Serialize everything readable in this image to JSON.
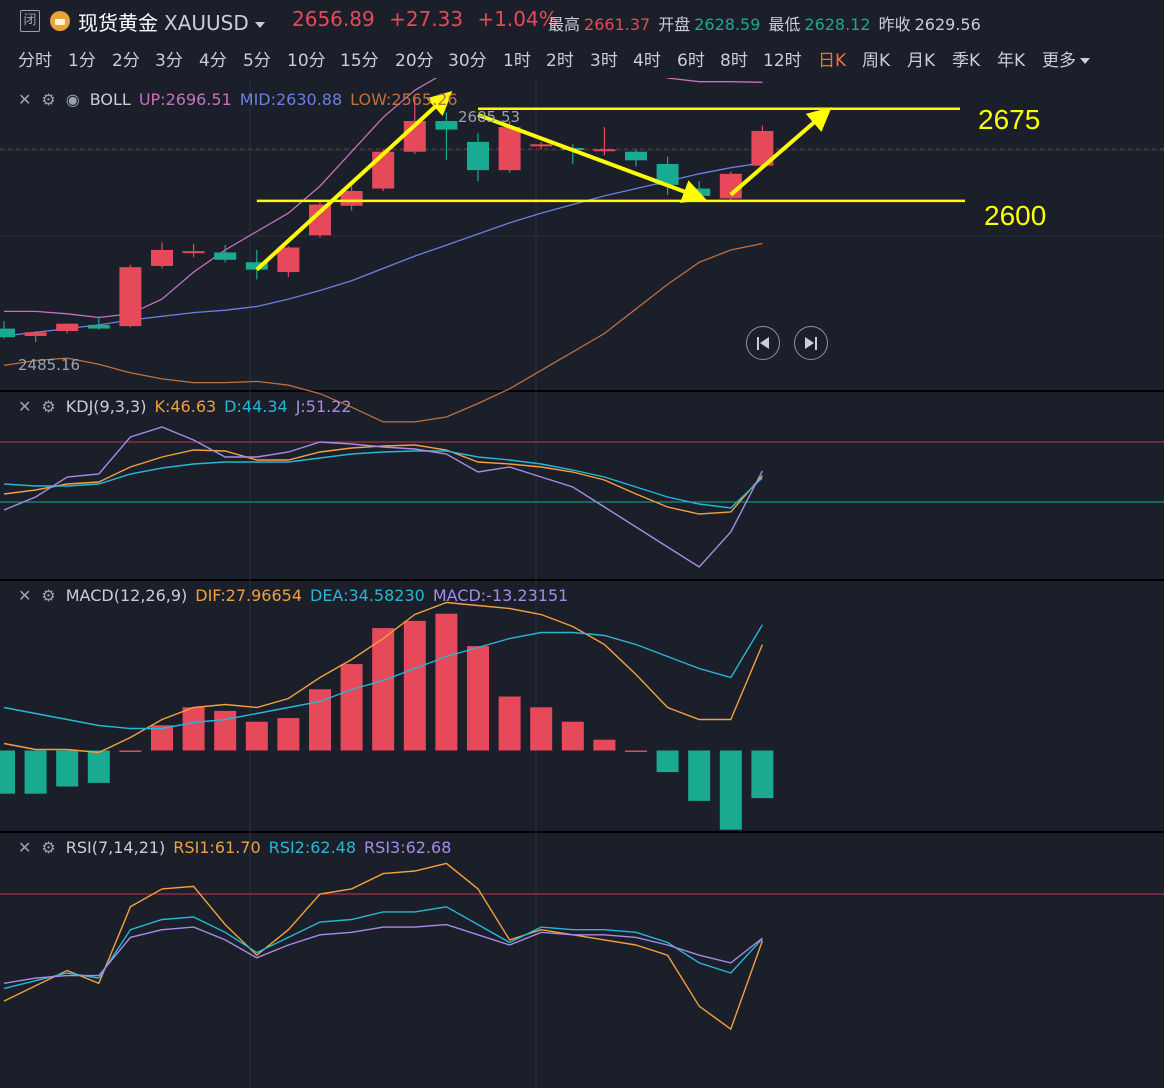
{
  "header": {
    "close_label": "闭",
    "symbol_name": "现货黄金",
    "symbol_code": "XAUUSD",
    "last_price": "2656.89",
    "change": "+27.33",
    "change_pct": "+1.04%",
    "high_label": "最高",
    "high_value": "2661.37",
    "open_label": "开盘",
    "open_value": "2628.59",
    "low_label": "最低",
    "low_value": "2628.12",
    "prev_close_label": "昨收",
    "prev_close_value": "2629.56"
  },
  "tabs": [
    "分时",
    "1分",
    "2分",
    "3分",
    "4分",
    "5分",
    "10分",
    "15分",
    "20分",
    "30分",
    "1时",
    "2时",
    "3时",
    "4时",
    "6时",
    "8时",
    "12时",
    "日K",
    "周K",
    "月K",
    "季K",
    "年K",
    "更多"
  ],
  "active_tab": "日K",
  "colors": {
    "up": "#e64a5a",
    "down": "#1aa991",
    "annot": "#ffff00",
    "boll_up": "#c86fc3",
    "boll_mid": "#6b7fe0",
    "boll_low": "#c06f3e"
  },
  "panels": {
    "boll": {
      "name": "BOLL",
      "up": "UP:2696.51",
      "mid": "MID:2630.88",
      "low": "LOW:2565.26",
      "max_label": "2685.53",
      "min_label": "2485.16"
    },
    "kdj": {
      "name": "KDJ(9,3,3)",
      "k": "K:46.63",
      "d": "D:44.34",
      "j": "J:51.22"
    },
    "macd": {
      "name": "MACD(12,26,9)",
      "dif": "DIF:27.96654",
      "dea": "DEA:34.58230",
      "macd": "MACD:-13.23151"
    },
    "rsi": {
      "name": "RSI(7,14,21)",
      "r1": "RSI1:61.70",
      "r2": "RSI2:62.48",
      "r3": "RSI3:62.68"
    }
  },
  "annotations": {
    "level_high": "2675",
    "level_low": "2600"
  },
  "chart_data": [
    {
      "type": "candlestick",
      "title": "BOLL",
      "candles": [
        {
          "o": 2496,
          "h": 2502,
          "l": 2488,
          "c": 2489
        },
        {
          "o": 2490,
          "h": 2494,
          "l": 2485,
          "c": 2493
        },
        {
          "o": 2494,
          "h": 2500,
          "l": 2492,
          "c": 2500
        },
        {
          "o": 2499,
          "h": 2506,
          "l": 2495,
          "c": 2496
        },
        {
          "o": 2498,
          "h": 2548,
          "l": 2497,
          "c": 2546
        },
        {
          "o": 2547,
          "h": 2566,
          "l": 2545,
          "c": 2560
        },
        {
          "o": 2558,
          "h": 2565,
          "l": 2554,
          "c": 2559
        },
        {
          "o": 2558,
          "h": 2564,
          "l": 2550,
          "c": 2552
        },
        {
          "o": 2550,
          "h": 2560,
          "l": 2536,
          "c": 2544
        },
        {
          "o": 2542,
          "h": 2563,
          "l": 2538,
          "c": 2562
        },
        {
          "o": 2572,
          "h": 2600,
          "l": 2570,
          "c": 2597
        },
        {
          "o": 2596,
          "h": 2612,
          "l": 2592,
          "c": 2608
        },
        {
          "o": 2610,
          "h": 2642,
          "l": 2608,
          "c": 2640
        },
        {
          "o": 2640,
          "h": 2685.53,
          "l": 2638,
          "c": 2665
        },
        {
          "o": 2665,
          "h": 2672,
          "l": 2633,
          "c": 2658
        },
        {
          "o": 2648,
          "h": 2655,
          "l": 2616,
          "c": 2625
        },
        {
          "o": 2625,
          "h": 2665,
          "l": 2623,
          "c": 2660
        },
        {
          "o": 2645,
          "h": 2648,
          "l": 2642,
          "c": 2646
        },
        {
          "o": 2643,
          "h": 2646,
          "l": 2630,
          "c": 2642
        },
        {
          "o": 2641,
          "h": 2660,
          "l": 2637,
          "c": 2642
        },
        {
          "o": 2640,
          "h": 2642,
          "l": 2628,
          "c": 2633
        },
        {
          "o": 2630,
          "h": 2636,
          "l": 2605,
          "c": 2613
        },
        {
          "o": 2610,
          "h": 2616,
          "l": 2601,
          "c": 2604
        },
        {
          "o": 2602,
          "h": 2624,
          "l": 2600,
          "c": 2622
        },
        {
          "o": 2628.59,
          "h": 2661.37,
          "l": 2628.12,
          "c": 2656.89
        }
      ],
      "boll_up": [
        2510,
        2510,
        2508,
        2505,
        2508,
        2520,
        2542,
        2560,
        2575,
        2590,
        2612,
        2640,
        2668,
        2690,
        2705,
        2712,
        2718,
        2720,
        2720,
        2718,
        2710,
        2700,
        2697,
        2697,
        2696.51
      ],
      "boll_mid": [
        2490,
        2493,
        2496,
        2499,
        2503,
        2506,
        2509,
        2511,
        2514,
        2520,
        2527,
        2535,
        2545,
        2555,
        2564,
        2573,
        2582,
        2590,
        2597,
        2604,
        2610,
        2616,
        2622,
        2627,
        2630.88
      ],
      "boll_low": [
        2466,
        2470,
        2472,
        2467,
        2460,
        2455,
        2452,
        2452,
        2453,
        2450,
        2443,
        2432,
        2420,
        2420,
        2424,
        2435,
        2447,
        2462,
        2477,
        2492,
        2512,
        2532,
        2550,
        2560,
        2565.26
      ],
      "ylim": [
        2446,
        2700
      ]
    },
    {
      "type": "line",
      "title": "KDJ(9,3,3)",
      "series": [
        {
          "name": "K",
          "values": [
            28,
            32,
            38,
            40,
            55,
            65,
            72,
            71,
            62,
            62,
            70,
            74,
            76,
            77,
            72,
            60,
            58,
            55,
            50,
            42,
            28,
            15,
            8,
            10,
            46.63
          ]
        },
        {
          "name": "D",
          "values": [
            38,
            36,
            36,
            38,
            48,
            54,
            58,
            60,
            60,
            60,
            64,
            68,
            70,
            71,
            71,
            65,
            62,
            58,
            52,
            45,
            35,
            25,
            18,
            14,
            44.34
          ]
        },
        {
          "name": "J",
          "values": [
            12,
            25,
            45,
            48,
            85,
            95,
            82,
            65,
            65,
            70,
            80,
            78,
            75,
            73,
            68,
            50,
            55,
            45,
            35,
            15,
            -5,
            -25,
            -45,
            -10,
            51.22
          ]
        }
      ]
    },
    {
      "type": "bar+line",
      "title": "MACD(12,26,9)",
      "series": [
        {
          "name": "DIF",
          "values": [
            -5,
            -7,
            -7,
            -8,
            -3,
            3,
            7,
            8,
            7,
            10,
            17,
            23,
            30,
            38,
            42,
            41,
            40,
            38,
            34,
            28,
            18,
            7,
            3,
            3,
            27.96654
          ]
        },
        {
          "name": "DEA",
          "values": [
            7,
            5,
            3,
            1,
            0,
            0,
            2,
            3,
            5,
            7,
            9,
            13,
            16,
            20,
            24,
            27,
            30,
            32,
            32,
            31,
            28,
            24,
            20,
            17,
            34.5823
          ]
        },
        {
          "name": "MACD",
          "values": [
            -12,
            -12,
            -10,
            -9,
            0,
            7,
            12,
            11,
            8,
            9,
            17,
            24,
            34,
            36,
            38,
            29,
            15,
            12,
            8,
            3,
            0,
            -6,
            -14,
            -22,
            -13.23151
          ]
        }
      ]
    },
    {
      "type": "line",
      "title": "RSI(7,14,21)",
      "series": [
        {
          "name": "RSI1",
          "values": [
            38,
            44,
            50,
            45,
            75,
            82,
            83,
            68,
            56,
            66,
            80,
            82,
            88,
            89,
            92,
            82,
            62,
            66,
            64,
            62,
            60,
            56,
            36,
            27,
            61.7
          ]
        },
        {
          "name": "RSI2",
          "values": [
            43,
            46,
            49,
            47,
            66,
            70,
            71,
            65,
            57,
            63,
            69,
            70,
            73,
            73,
            75,
            68,
            61,
            67,
            66,
            66,
            65,
            61,
            53,
            49,
            62.48
          ]
        },
        {
          "name": "RSI3",
          "values": [
            45,
            47,
            48,
            48,
            63,
            66,
            67,
            62,
            55,
            60,
            64,
            65,
            67,
            67,
            68,
            64,
            60,
            65,
            64,
            64,
            63,
            60,
            56,
            53,
            62.68
          ]
        }
      ]
    }
  ]
}
